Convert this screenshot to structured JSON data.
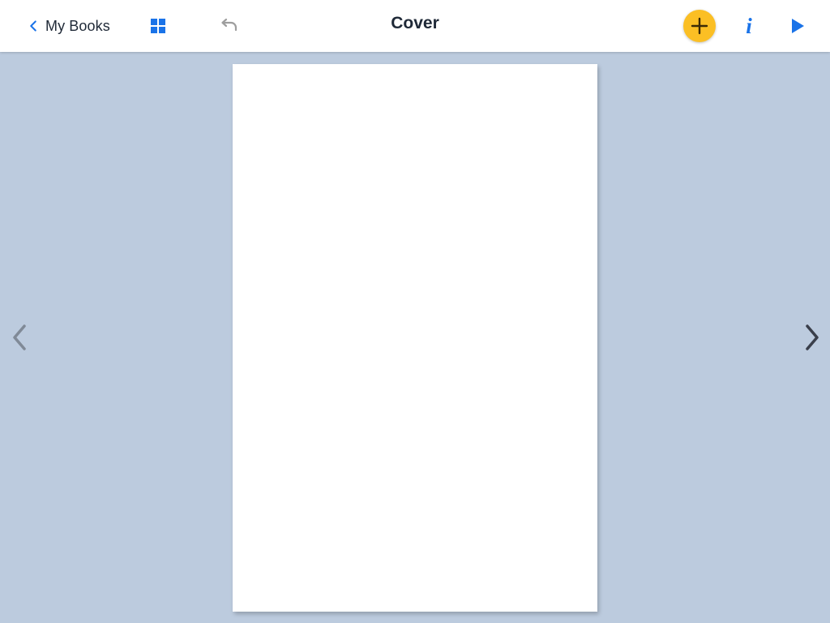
{
  "toolbar": {
    "back_label": "My Books",
    "title": "Cover",
    "info_label": "i",
    "icons": {
      "back": "chevron-left-icon",
      "pages_grid": "grid-icon",
      "undo": "undo-icon",
      "add": "plus-icon",
      "info": "info-icon",
      "play": "play-icon"
    }
  },
  "navigation": {
    "prev_icon": "chevron-left-icon",
    "next_icon": "chevron-right-icon"
  },
  "colors": {
    "accent": "#1a73e8",
    "add_button": "#fbbf24",
    "workspace_background": "#bccbde",
    "page_background": "#ffffff"
  }
}
